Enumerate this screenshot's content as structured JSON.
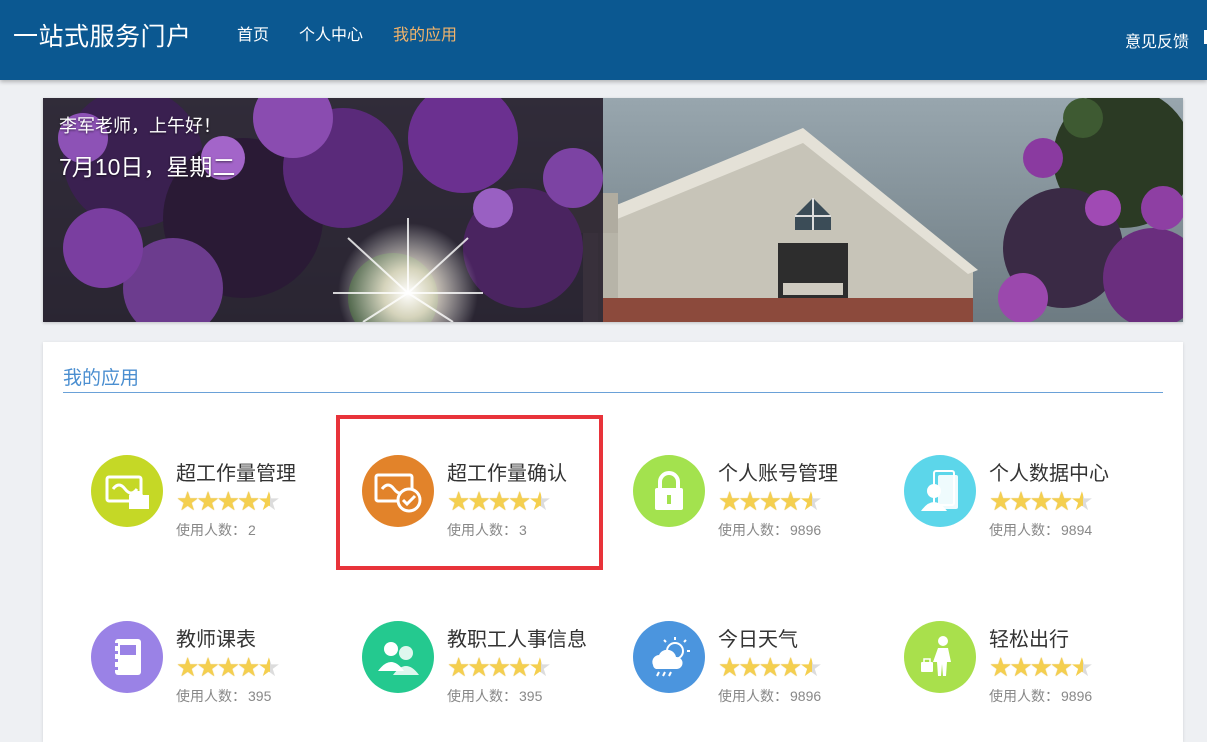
{
  "header": {
    "brand": "一站式服务门户",
    "nav": [
      "首页",
      "个人中心",
      "我的应用"
    ],
    "active_nav": "我的应用",
    "feedback": "意见反馈",
    "colors": {
      "bar": "#0b5891",
      "active": "#f2b36b"
    }
  },
  "banner": {
    "greeting": "李军老师，上午好！",
    "date": "7月10日，星期二"
  },
  "apps_panel": {
    "title": "我的应用",
    "usage_label": "使用人数：",
    "apps": [
      {
        "name": "超工作量管理",
        "rating": 4.5,
        "usage": "2",
        "color": "#c5d826",
        "icon": "workload-folder-icon"
      },
      {
        "name": "超工作量确认",
        "rating": 4.5,
        "usage": "3",
        "color": "#e2832a",
        "icon": "workload-confirm-icon"
      },
      {
        "name": "个人账号管理",
        "rating": 4.5,
        "usage": "9896",
        "color": "#a3e24e",
        "icon": "lock-icon"
      },
      {
        "name": "个人数据中心",
        "rating": 4.5,
        "usage": "9894",
        "color": "#5cd6ea",
        "icon": "person-card-icon"
      },
      {
        "name": "教师课表",
        "rating": 4.5,
        "usage": "395",
        "color": "#9a82e6",
        "icon": "notebook-icon"
      },
      {
        "name": "教职工人事信息",
        "rating": 4.5,
        "usage": "395",
        "color": "#24c98f",
        "icon": "people-icon"
      },
      {
        "name": "今日天气",
        "rating": 4.5,
        "usage": "9896",
        "color": "#4b95de",
        "icon": "weather-icon"
      },
      {
        "name": "轻松出行",
        "rating": 4.5,
        "usage": "9896",
        "color": "#a9e04c",
        "icon": "traveler-icon"
      }
    ]
  }
}
